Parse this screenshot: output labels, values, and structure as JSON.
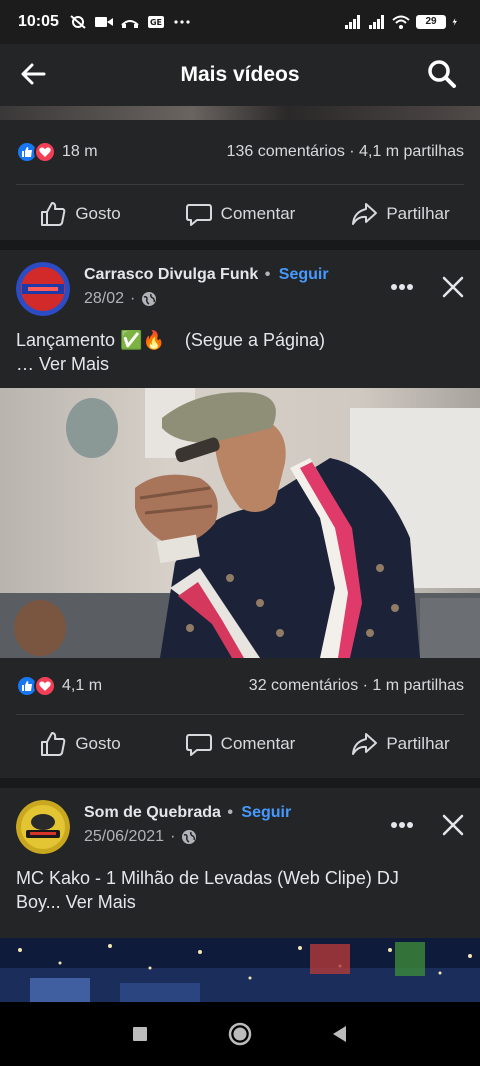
{
  "status_bar": {
    "time": "10:05",
    "battery": "29"
  },
  "app_bar": {
    "title": "Mais vídeos"
  },
  "colors": {
    "accent": "#4599ff",
    "like_blue": "#1877f2",
    "love_red": "#f33e58",
    "card_bg": "#242526",
    "page_bg": "#18191a"
  },
  "posts": [
    {
      "reactions": "18 m",
      "comments_shares": "136 comentários · 4,1 m partilhas",
      "actions": {
        "like": "Gosto",
        "comment": "Comentar",
        "share": "Partilhar"
      }
    },
    {
      "page_name": "Carrasco Divulga Funk",
      "follow": "Seguir",
      "date": "28/02",
      "caption_line1": "Lançamento ✅🔥    (Segue a Página)",
      "caption_line2": "… Ver Mais",
      "reactions": "4,1 m",
      "comments_shares": "32 comentários · 1 m partilhas",
      "actions": {
        "like": "Gosto",
        "comment": "Comentar",
        "share": "Partilhar"
      }
    },
    {
      "page_name": "Som de Quebrada",
      "follow": "Seguir",
      "date": "25/06/2021",
      "caption_line1": "MC Kako - 1 Milhão de Levadas (Web Clipe) DJ",
      "caption_line2": "Boy... Ver Mais"
    }
  ],
  "icons": [
    "back-arrow-icon",
    "search-icon",
    "like-icon",
    "comment-icon",
    "share-icon",
    "more-icon",
    "close-icon",
    "globe-icon",
    "nav-recents-icon",
    "nav-home-icon",
    "nav-back-icon"
  ]
}
